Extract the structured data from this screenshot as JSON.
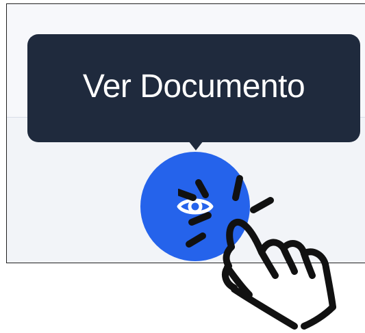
{
  "tooltip": {
    "label": "Ver Documento"
  },
  "view_button": {
    "icon": "eye-icon",
    "color": "#2563eb"
  },
  "overlay": {
    "icon": "pointing-hand-icon"
  },
  "colors": {
    "tooltip_bg": "#1f2a3d",
    "button": "#2563eb",
    "panel_bg": "#f2f4f8"
  }
}
